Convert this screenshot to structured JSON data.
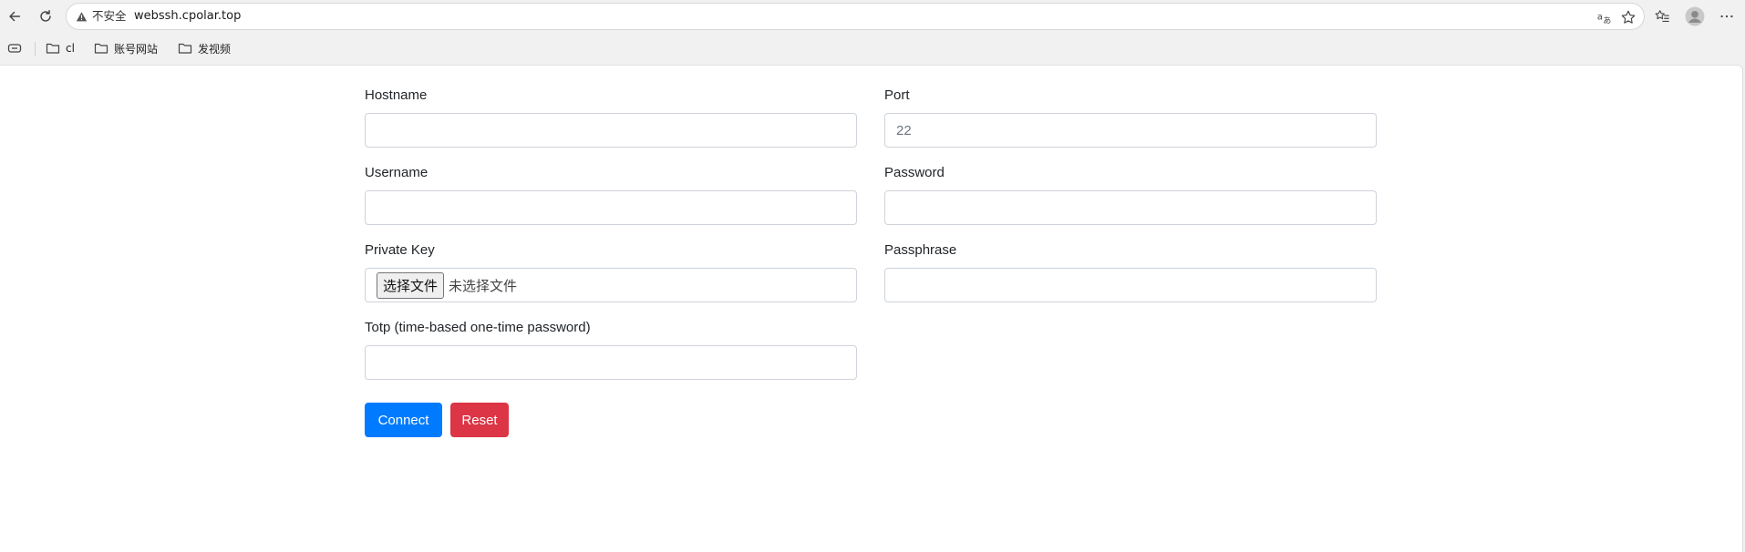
{
  "browser": {
    "security_label": "不安全",
    "url": "webssh.cpolar.top",
    "icons": {
      "back": "back-arrow-icon",
      "reload": "reload-icon",
      "warning": "warning-triangle-icon",
      "translate": "translate-icon",
      "favorite": "star-icon",
      "favorites_list": "favorites-list-icon",
      "profile": "profile-avatar-icon",
      "more": "more-dots-icon"
    }
  },
  "bookmarks": {
    "items": [
      {
        "label": "cl",
        "icon": "folder-icon"
      },
      {
        "label": "账号网站",
        "icon": "folder-icon"
      },
      {
        "label": "发视频",
        "icon": "folder-icon"
      }
    ]
  },
  "form": {
    "hostname": {
      "label": "Hostname",
      "value": "",
      "placeholder": ""
    },
    "port": {
      "label": "Port",
      "value": "",
      "placeholder": "22"
    },
    "username": {
      "label": "Username",
      "value": "",
      "placeholder": ""
    },
    "password": {
      "label": "Password",
      "value": "",
      "placeholder": ""
    },
    "private_key": {
      "label": "Private Key",
      "button": "选择文件",
      "status": "未选择文件"
    },
    "passphrase": {
      "label": "Passphrase",
      "value": "",
      "placeholder": ""
    },
    "totp": {
      "label": "Totp (time-based one-time password)",
      "value": "",
      "placeholder": ""
    },
    "connect_label": "Connect",
    "reset_label": "Reset"
  },
  "colors": {
    "primary": "#007bff",
    "danger": "#dc3545",
    "input_border": "#ced4da"
  }
}
